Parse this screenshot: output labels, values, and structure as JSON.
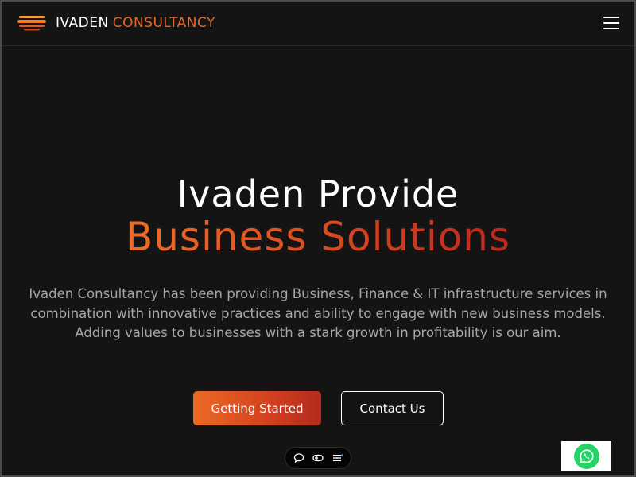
{
  "header": {
    "brand_primary": "IVADEN",
    "brand_secondary": "CONSULTANCY",
    "menu_icon": "hamburger-menu-icon"
  },
  "hero": {
    "title_line1": "Ivaden Provide",
    "title_line2": "Business Solutions",
    "description": "Ivaden Consultancy has been providing Business, Finance & IT infrastructure services in combination with innovative practices and ability to engage with new business models. Adding values to businesses with a stark growth in profitability is our aim."
  },
  "buttons": {
    "primary_label": "Getting Started",
    "secondary_label": "Contact Us"
  },
  "widget": {
    "icons": [
      "chat-bubble-icon",
      "toggle-icon",
      "list-icon"
    ]
  },
  "whatsapp": {
    "icon": "whatsapp-icon"
  },
  "colors": {
    "background": "#141414",
    "accent_orange": "#ec6a25",
    "accent_red": "#b32a1f",
    "text_muted": "#a7a7a7",
    "whatsapp_green": "#25d366"
  }
}
